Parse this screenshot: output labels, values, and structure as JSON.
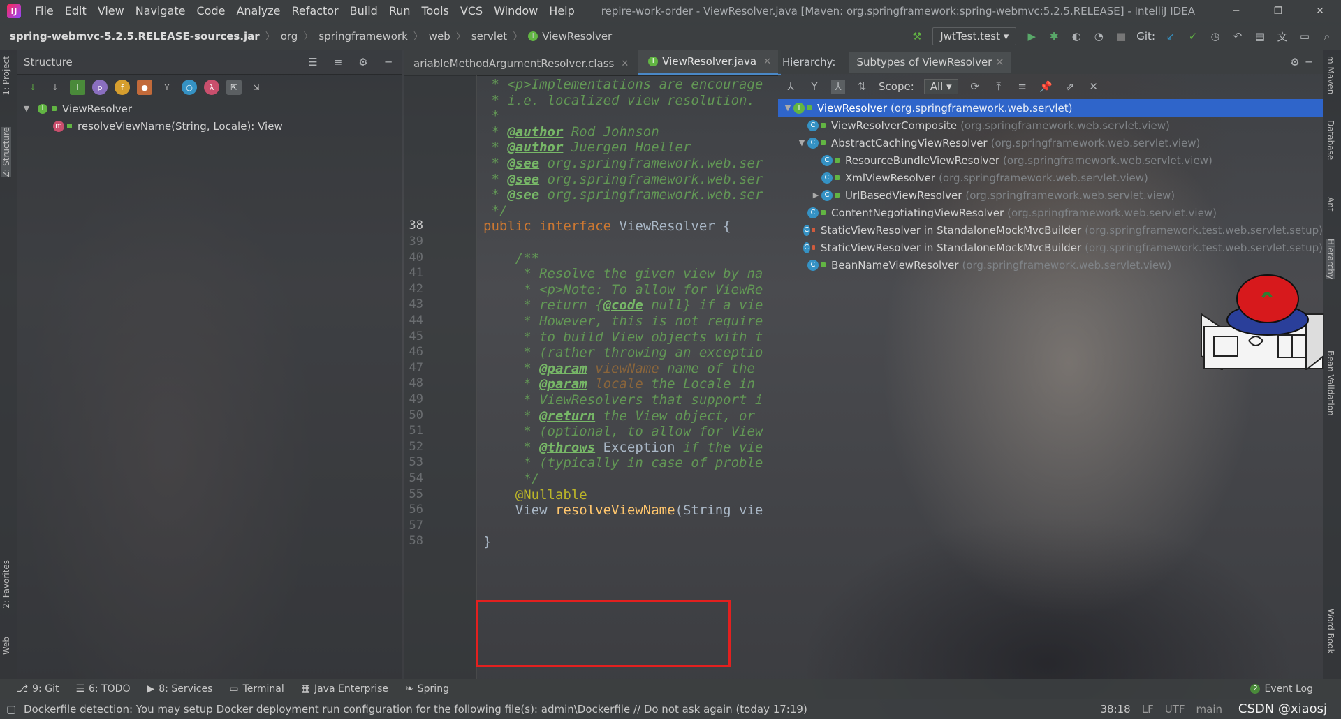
{
  "app": {
    "menu": [
      "File",
      "Edit",
      "View",
      "Navigate",
      "Code",
      "Analyze",
      "Refactor",
      "Build",
      "Run",
      "Tools",
      "VCS",
      "Window",
      "Help"
    ],
    "window_title": "repire-work-order - ViewResolver.java [Maven: org.springframework:spring-webmvc:5.2.5.RELEASE] - IntelliJ IDEA"
  },
  "nav": {
    "crumbs": [
      "spring-webmvc-5.2.5.RELEASE-sources.jar",
      "org",
      "springframework",
      "web",
      "servlet",
      "ViewResolver"
    ],
    "run_config": "JwtTest.test",
    "git_label": "Git:"
  },
  "left_strip": {
    "project": "1: Project",
    "structure": "Z: Structure",
    "favorites": "2: Favorites",
    "web": "Web"
  },
  "structure": {
    "title": "Structure",
    "tree": [
      {
        "label": "ViewResolver"
      },
      {
        "label": "resolveViewName(String, Locale): View"
      }
    ]
  },
  "editor": {
    "tabs": [
      {
        "label": "ariableMethodArgumentResolver.class"
      },
      {
        "label": "ViewResolver.java"
      }
    ],
    "lines": [
      {
        "ln": "",
        "parts": [
          {
            "c": "doc",
            "t": " * <p>Implementations are encourage"
          }
        ]
      },
      {
        "ln": "",
        "parts": [
          {
            "c": "doc",
            "t": " * i.e. localized view resolution."
          }
        ]
      },
      {
        "ln": "",
        "parts": [
          {
            "c": "doc",
            "t": " *"
          }
        ]
      },
      {
        "ln": "",
        "parts": [
          {
            "c": "doc",
            "t": " * "
          },
          {
            "c": "tag",
            "t": "@author"
          },
          {
            "c": "doc",
            "t": " Rod Johnson"
          }
        ]
      },
      {
        "ln": "",
        "parts": [
          {
            "c": "doc",
            "t": " * "
          },
          {
            "c": "tag",
            "t": "@author"
          },
          {
            "c": "doc",
            "t": " Juergen Hoeller"
          }
        ]
      },
      {
        "ln": "",
        "parts": [
          {
            "c": "doc",
            "t": " * "
          },
          {
            "c": "tag",
            "t": "@see"
          },
          {
            "c": "doc",
            "t": " org.springframework.web.ser"
          }
        ]
      },
      {
        "ln": "",
        "parts": [
          {
            "c": "doc",
            "t": " * "
          },
          {
            "c": "tag",
            "t": "@see"
          },
          {
            "c": "doc",
            "t": " org.springframework.web.ser"
          }
        ]
      },
      {
        "ln": "",
        "parts": [
          {
            "c": "doc",
            "t": " * "
          },
          {
            "c": "tag",
            "t": "@see"
          },
          {
            "c": "doc",
            "t": " org.springframework.web.ser"
          }
        ]
      },
      {
        "ln": "",
        "parts": [
          {
            "c": "doc",
            "t": " */"
          }
        ]
      },
      {
        "ln": "38",
        "parts": [
          {
            "c": "kw",
            "t": "public interface "
          },
          {
            "c": "plain",
            "t": "ViewResolver {"
          }
        ]
      },
      {
        "ln": "39",
        "parts": []
      },
      {
        "ln": "40",
        "parts": [
          {
            "c": "doc",
            "t": "    /**"
          }
        ]
      },
      {
        "ln": "41",
        "parts": [
          {
            "c": "doc",
            "t": "     * Resolve the given view by na"
          }
        ]
      },
      {
        "ln": "42",
        "parts": [
          {
            "c": "doc",
            "t": "     * <p>Note: To allow for ViewRe"
          }
        ]
      },
      {
        "ln": "43",
        "parts": [
          {
            "c": "doc",
            "t": "     * return {"
          },
          {
            "c": "tag",
            "t": "@code"
          },
          {
            "c": "doc",
            "t": " null} if a vie"
          }
        ]
      },
      {
        "ln": "44",
        "parts": [
          {
            "c": "doc",
            "t": "     * However, this is not require"
          }
        ]
      },
      {
        "ln": "45",
        "parts": [
          {
            "c": "doc",
            "t": "     * to build View objects with t"
          }
        ]
      },
      {
        "ln": "46",
        "parts": [
          {
            "c": "doc",
            "t": "     * (rather throwing an exceptio"
          }
        ]
      },
      {
        "ln": "47",
        "parts": [
          {
            "c": "doc",
            "t": "     * "
          },
          {
            "c": "tag",
            "t": "@param"
          },
          {
            "c": "tagname",
            "t": " viewName"
          },
          {
            "c": "doc",
            "t": " name of the"
          }
        ]
      },
      {
        "ln": "48",
        "parts": [
          {
            "c": "doc",
            "t": "     * "
          },
          {
            "c": "tag",
            "t": "@param"
          },
          {
            "c": "tagname",
            "t": " locale"
          },
          {
            "c": "doc",
            "t": " the Locale in"
          }
        ]
      },
      {
        "ln": "49",
        "parts": [
          {
            "c": "doc",
            "t": "     * ViewResolvers that support i"
          }
        ]
      },
      {
        "ln": "50",
        "parts": [
          {
            "c": "doc",
            "t": "     * "
          },
          {
            "c": "tag",
            "t": "@return"
          },
          {
            "c": "doc",
            "t": " the View object, or"
          }
        ]
      },
      {
        "ln": "51",
        "parts": [
          {
            "c": "doc",
            "t": "     * (optional, to allow for View"
          }
        ]
      },
      {
        "ln": "52",
        "parts": [
          {
            "c": "doc",
            "t": "     * "
          },
          {
            "c": "tag",
            "t": "@throws"
          },
          {
            "c": "plain",
            "t": " Exception"
          },
          {
            "c": "doc",
            "t": " if the vie"
          }
        ]
      },
      {
        "ln": "53",
        "parts": [
          {
            "c": "doc",
            "t": "     * (typically in case of proble"
          }
        ]
      },
      {
        "ln": "54",
        "parts": [
          {
            "c": "doc",
            "t": "     */"
          }
        ]
      },
      {
        "ln": "55",
        "parts": [
          {
            "c": "ann",
            "t": "    @Nullable"
          }
        ]
      },
      {
        "ln": "56",
        "parts": [
          {
            "c": "plain",
            "t": "    View "
          },
          {
            "c": "fn",
            "t": "resolveViewName"
          },
          {
            "c": "plain",
            "t": "(String vie"
          }
        ]
      },
      {
        "ln": "57",
        "parts": []
      },
      {
        "ln": "58",
        "parts": [
          {
            "c": "plain",
            "t": "}"
          }
        ]
      }
    ]
  },
  "hierarchy": {
    "label": "Hierarchy:",
    "tab": "Subtypes of ViewResolver",
    "scope_label": "Scope:",
    "scope_value": "All",
    "rows": [
      {
        "name": "ViewResolver",
        "pkg": "(org.springframework.web.servlet)",
        "level": 0,
        "twisty": "▼",
        "selected": true,
        "access": "pub",
        "kind": "i"
      },
      {
        "name": "ViewResolverComposite",
        "pkg": "(org.springframework.web.servlet.view)",
        "level": 1,
        "twisty": "",
        "selected": false,
        "access": "pub",
        "kind": "c"
      },
      {
        "name": "AbstractCachingViewResolver",
        "pkg": "(org.springframework.web.servlet.view)",
        "level": 1,
        "twisty": "▼",
        "selected": false,
        "access": "pub",
        "kind": "c"
      },
      {
        "name": "ResourceBundleViewResolver",
        "pkg": "(org.springframework.web.servlet.view)",
        "level": 2,
        "twisty": "",
        "selected": false,
        "access": "pub",
        "kind": "c"
      },
      {
        "name": "XmlViewResolver",
        "pkg": "(org.springframework.web.servlet.view)",
        "level": 2,
        "twisty": "",
        "selected": false,
        "access": "pub",
        "kind": "c"
      },
      {
        "name": "UrlBasedViewResolver",
        "pkg": "(org.springframework.web.servlet.view)",
        "level": 2,
        "twisty": "▶",
        "selected": false,
        "access": "pub",
        "kind": "c"
      },
      {
        "name": "ContentNegotiatingViewResolver",
        "pkg": "(org.springframework.web.servlet.view)",
        "level": 1,
        "twisty": "",
        "selected": false,
        "access": "pub",
        "kind": "c"
      },
      {
        "name": "StaticViewResolver in StandaloneMockMvcBuilder",
        "pkg": "(org.springframework.test.web.servlet.setup)",
        "level": 1,
        "twisty": "",
        "selected": false,
        "access": "priv",
        "kind": "c"
      },
      {
        "name": "StaticViewResolver in StandaloneMockMvcBuilder",
        "pkg": "(org.springframework.test.web.servlet.setup)",
        "level": 1,
        "twisty": "",
        "selected": false,
        "access": "priv",
        "kind": "c"
      },
      {
        "name": "BeanNameViewResolver",
        "pkg": "(org.springframework.web.servlet.view)",
        "level": 1,
        "twisty": "",
        "selected": false,
        "access": "pub",
        "kind": "c"
      }
    ]
  },
  "right_strip": {
    "maven": "m Maven",
    "database": "Database",
    "ant": "Ant",
    "hierarchy": "Hierarchy",
    "validation": "Bean Validation",
    "wordbook": "Word Book"
  },
  "toolwindows": {
    "items": [
      "9: Git",
      "6: TODO",
      "8: Services",
      "Terminal",
      "Java Enterprise",
      "Spring"
    ],
    "event_log": "Event Log",
    "event_count": "2"
  },
  "status": {
    "message": "Dockerfile detection: You may setup Docker deployment run configuration for the following file(s): admin\\Dockerfile // Do not ask again (today 17:19)",
    "position": "38:18",
    "line_sep": "LF",
    "encoding": "UTF",
    "branch": "main"
  },
  "watermark": "CSDN @xiaosj"
}
